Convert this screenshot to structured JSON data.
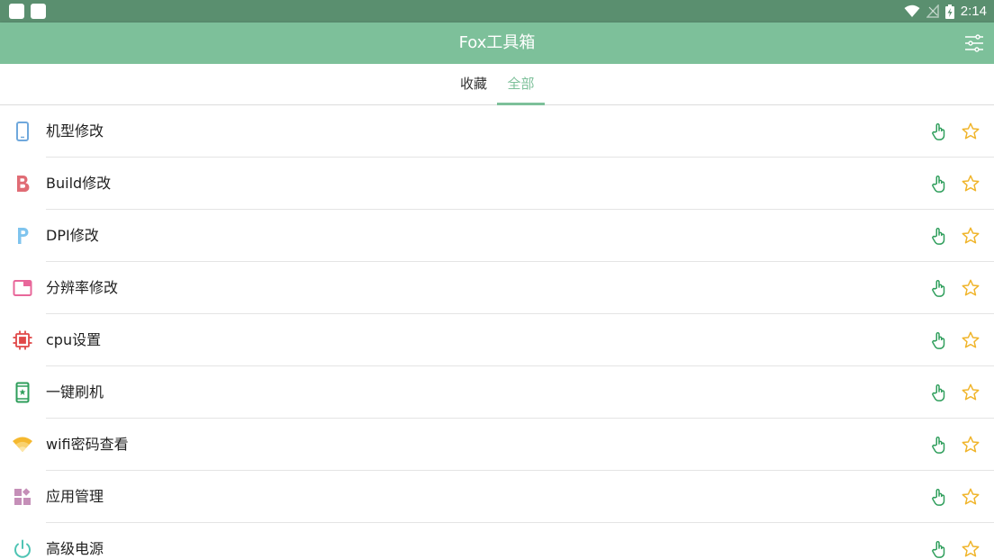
{
  "status_bar": {
    "time": "2:14"
  },
  "app_bar": {
    "title": "Fox工具箱",
    "settings_icon": "sliders-icon"
  },
  "tabs": [
    {
      "label": "收藏",
      "selected": false
    },
    {
      "label": "全部",
      "selected": true
    }
  ],
  "colors": {
    "accent": "#7dc09a",
    "status_bar": "#5a8f6f",
    "star": "#f0b429",
    "touch": "#2e9e5b"
  },
  "tools": [
    {
      "label": "机型修改",
      "icon": "phone-icon"
    },
    {
      "label": "Build修改",
      "icon": "letter-b-icon"
    },
    {
      "label": "DPI修改",
      "icon": "letter-p-icon"
    },
    {
      "label": "分辨率修改",
      "icon": "window-icon"
    },
    {
      "label": "cpu设置",
      "icon": "cpu-chip-icon"
    },
    {
      "label": "一键刷机",
      "icon": "phone-flash-icon"
    },
    {
      "label": "wifi密码查看",
      "icon": "wifi-icon"
    },
    {
      "label": "应用管理",
      "icon": "app-grid-icon"
    },
    {
      "label": "高级电源",
      "icon": "power-icon"
    }
  ]
}
